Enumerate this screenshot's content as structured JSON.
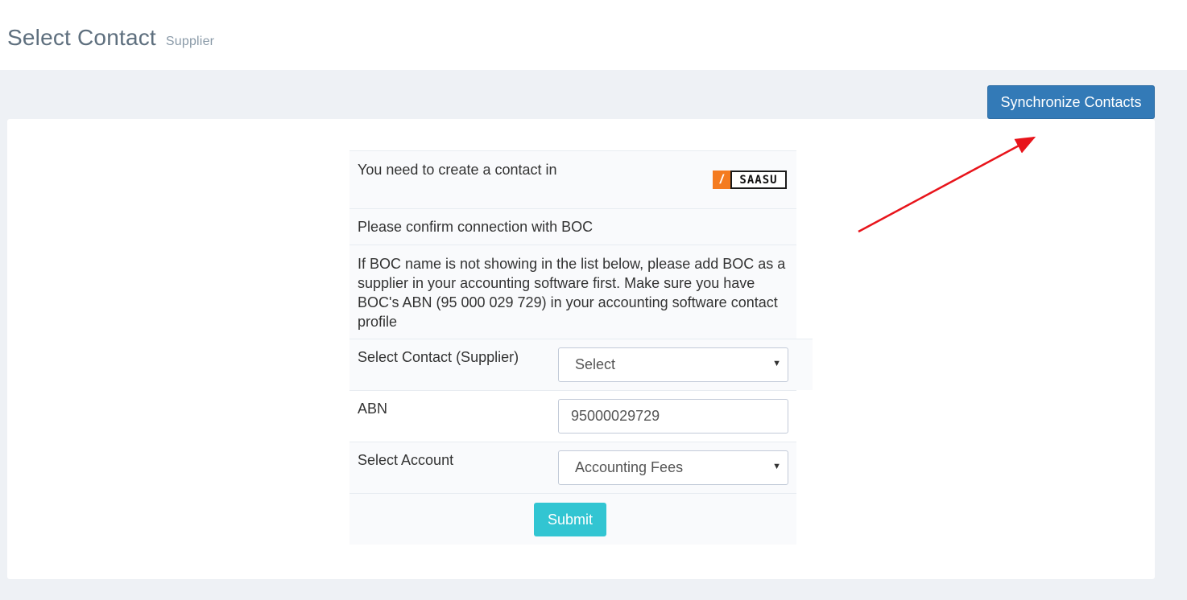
{
  "header": {
    "title": "Select Contact",
    "subtitle": "Supplier"
  },
  "toolbar": {
    "sync_label": "Synchronize Contacts"
  },
  "annotation": {
    "arrow_color": "#e8141b"
  },
  "form": {
    "intro_text": "You need to create a contact in",
    "logo": {
      "name": "saasu-logo",
      "mark": "/",
      "word": "SAASU"
    },
    "confirm_text": "Please confirm connection with BOC",
    "info_text": "If BOC name is not showing in the list below, please add BOC as a supplier in your accounting software first. Make sure you have BOC's ABN (95 000 029 729) in your accounting software contact profile",
    "contact": {
      "label": "Select Contact (Supplier)",
      "selected": "Select"
    },
    "abn": {
      "label": "ABN",
      "value": "95000029729"
    },
    "account": {
      "label": "Select Account",
      "selected": "Accounting Fees"
    },
    "submit_label": "Submit"
  },
  "colors": {
    "primary": "#337ab7",
    "submit": "#32c5d2",
    "title": "#5e6f7e",
    "background": "#eef1f5"
  }
}
